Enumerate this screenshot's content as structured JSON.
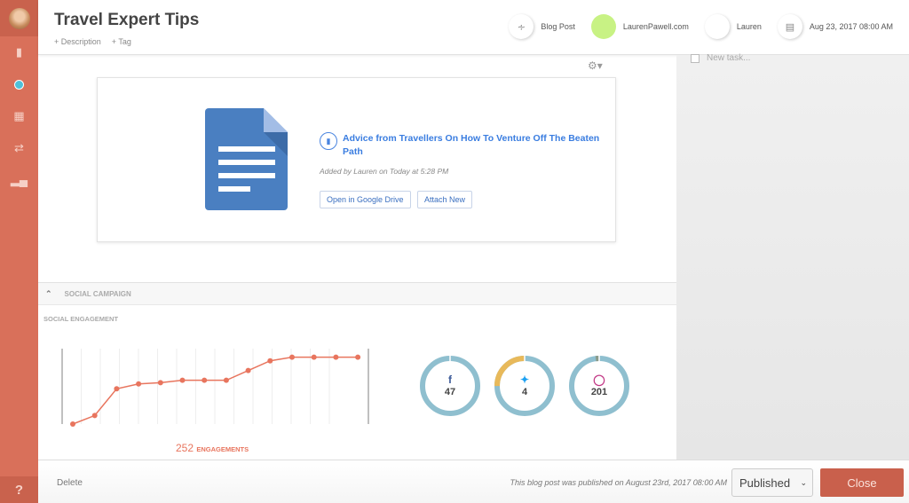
{
  "header": {
    "title": "Travel Expert Tips",
    "add_description": "+ Description",
    "add_tag": "+ Tag",
    "meta": [
      {
        "icon": "rss-icon",
        "label": "Blog Post"
      },
      {
        "icon": "green-dot",
        "label": "LaurenPawell.com",
        "color": "#c8f284"
      },
      {
        "icon": "avatar",
        "label": "Lauren"
      },
      {
        "icon": "calendar-icon",
        "label": "Aug 23, 2017 08:00 AM"
      }
    ]
  },
  "sidebar": {
    "items": [
      "clipboard-icon",
      "circle-icon",
      "calendar-icon",
      "shuffle-icon",
      "bar-chart-icon"
    ],
    "help": "?"
  },
  "tasks": {
    "new_task_placeholder": "New task..."
  },
  "attachment": {
    "title": "Advice from Travellers On How To Venture Off The Beaten Path",
    "added": "Added by Lauren on Today at 5:28 PM",
    "open_button": "Open in Google Drive",
    "attach_button": "Attach New"
  },
  "social": {
    "section_title": "SOCIAL CAMPAIGN",
    "subsection": "SOCIAL ENGAGEMENT",
    "engagements_count": "252",
    "engagements_label": "ENGAGEMENTS",
    "networks": [
      {
        "icon": "facebook-icon",
        "value": "47",
        "color": "#3b5998"
      },
      {
        "icon": "twitter-icon",
        "value": "4",
        "color": "#1da1f2"
      },
      {
        "icon": "instagram-icon",
        "value": "201",
        "color": "#c13584"
      }
    ]
  },
  "chart_data": {
    "type": "line",
    "values": [
      0,
      7,
      29,
      33,
      34,
      36,
      36,
      36,
      44,
      52,
      55,
      55,
      55,
      55
    ],
    "color": "#e8755e",
    "grid": true,
    "donuts": [
      {
        "main_fraction": 1.0,
        "accent_fraction": 0,
        "accent_color": "#8fbfcf"
      },
      {
        "main_fraction": 0.75,
        "accent_fraction": 0.25,
        "accent_color": "#e8b95a"
      },
      {
        "main_fraction": 0.98,
        "accent_fraction": 0.02,
        "accent_color": "#8a9a8a"
      }
    ]
  },
  "footer": {
    "delete": "Delete",
    "status_text": "This blog post was published on August 23rd, 2017 08:00 AM",
    "status_select": "Published",
    "close": "Close"
  }
}
